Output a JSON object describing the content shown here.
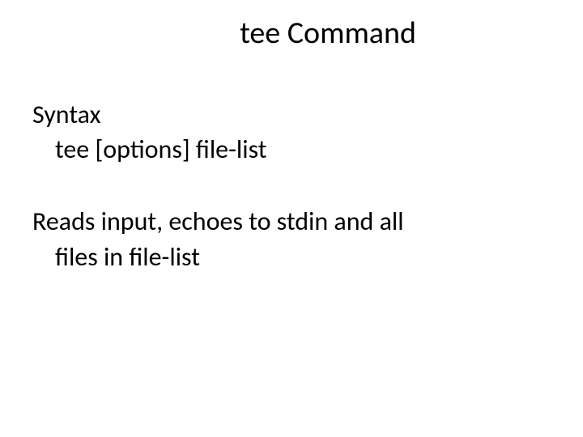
{
  "slide": {
    "title": "tee Command",
    "syntax": {
      "heading": "Syntax",
      "usage": "tee [options] file-list"
    },
    "description": {
      "line1": "Reads input, echoes to stdin and all",
      "line2": "files in file-list"
    }
  }
}
